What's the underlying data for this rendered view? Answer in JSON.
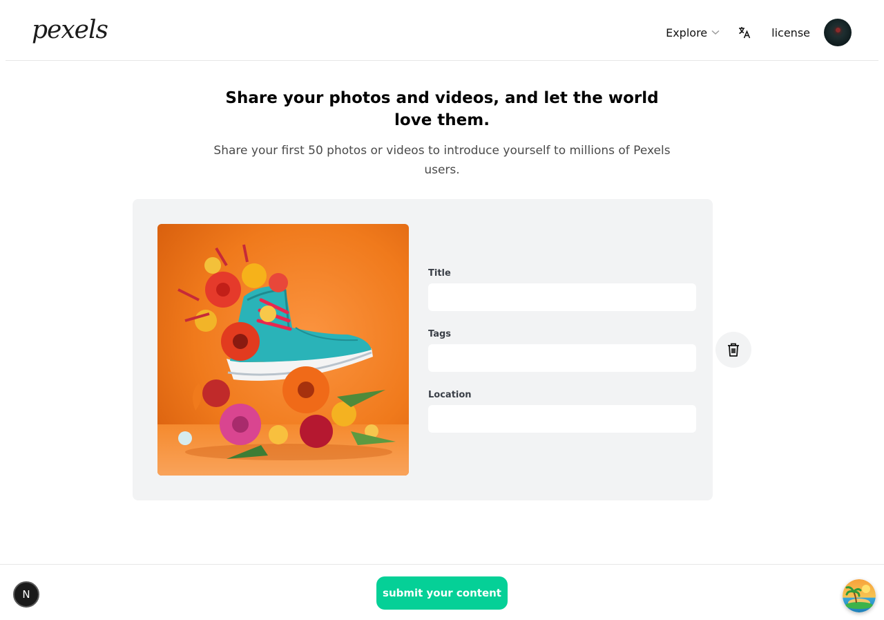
{
  "header": {
    "logo": "pexels",
    "nav": {
      "explore_label": "Explore",
      "license_label": "license"
    }
  },
  "hero": {
    "title": "Share your photos and videos, and let the world love them.",
    "subtitle": "Share your first 50 photos or videos to introduce yourself to millions of Pexels users."
  },
  "upload": {
    "fields": {
      "title_label": "Title",
      "title_value": "",
      "tags_label": "Tags",
      "tags_value": "",
      "location_label": "Location",
      "location_value": ""
    }
  },
  "footer": {
    "submit_label": "submit your content",
    "badge_letter": "N"
  },
  "colors": {
    "accent": "#05d097",
    "card_bg": "#f2f3f4",
    "photo_bg": "#f07a1c",
    "shoe": "#2ab3b8"
  },
  "icons": [
    "chevron-down-icon",
    "translate-icon",
    "trash-icon",
    "island-icon"
  ]
}
